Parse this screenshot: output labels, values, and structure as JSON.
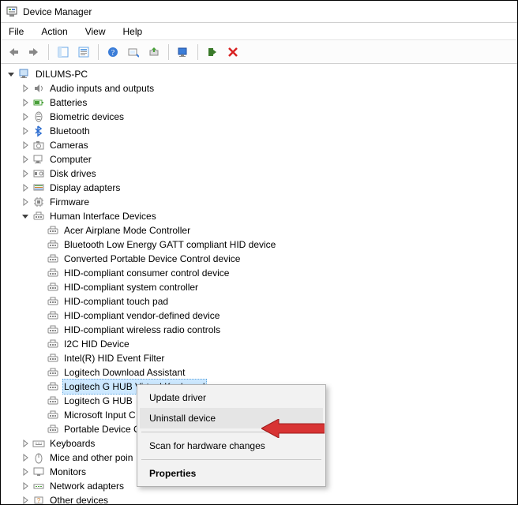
{
  "window": {
    "title": "Device Manager"
  },
  "menu": {
    "file": "File",
    "action": "Action",
    "view": "View",
    "help": "Help"
  },
  "tree": {
    "root": "DILUMS-PC",
    "categories": [
      {
        "label": "Audio inputs and outputs",
        "icon": "speaker"
      },
      {
        "label": "Batteries",
        "icon": "battery"
      },
      {
        "label": "Biometric devices",
        "icon": "finger"
      },
      {
        "label": "Bluetooth",
        "icon": "bluetooth"
      },
      {
        "label": "Cameras",
        "icon": "camera"
      },
      {
        "label": "Computer",
        "icon": "computer"
      },
      {
        "label": "Disk drives",
        "icon": "disk"
      },
      {
        "label": "Display adapters",
        "icon": "display"
      },
      {
        "label": "Firmware",
        "icon": "chip"
      },
      {
        "label": "Human Interface Devices",
        "icon": "hid",
        "expanded": true
      },
      {
        "label": "Keyboards",
        "icon": "keyboard"
      },
      {
        "label": "Mice and other poin",
        "icon": "mouse"
      },
      {
        "label": "Monitors",
        "icon": "monitor"
      },
      {
        "label": "Network adapters",
        "icon": "network"
      },
      {
        "label": "Other devices",
        "icon": "other"
      }
    ],
    "hid_devices": [
      "Acer Airplane Mode Controller",
      "Bluetooth Low Energy GATT compliant HID device",
      "Converted Portable Device Control device",
      "HID-compliant consumer control device",
      "HID-compliant system controller",
      "HID-compliant touch pad",
      "HID-compliant vendor-defined device",
      "HID-compliant wireless radio controls",
      "I2C HID Device",
      "Intel(R) HID Event Filter",
      "Logitech Download Assistant",
      "Logitech G HUB Virtual Keyboard",
      "Logitech G HUB",
      "Microsoft Input C",
      "Portable Device C"
    ],
    "selected_index": 11
  },
  "contextMenu": {
    "update": "Update driver",
    "uninstall": "Uninstall device",
    "scan": "Scan for hardware changes",
    "properties": "Properties"
  }
}
